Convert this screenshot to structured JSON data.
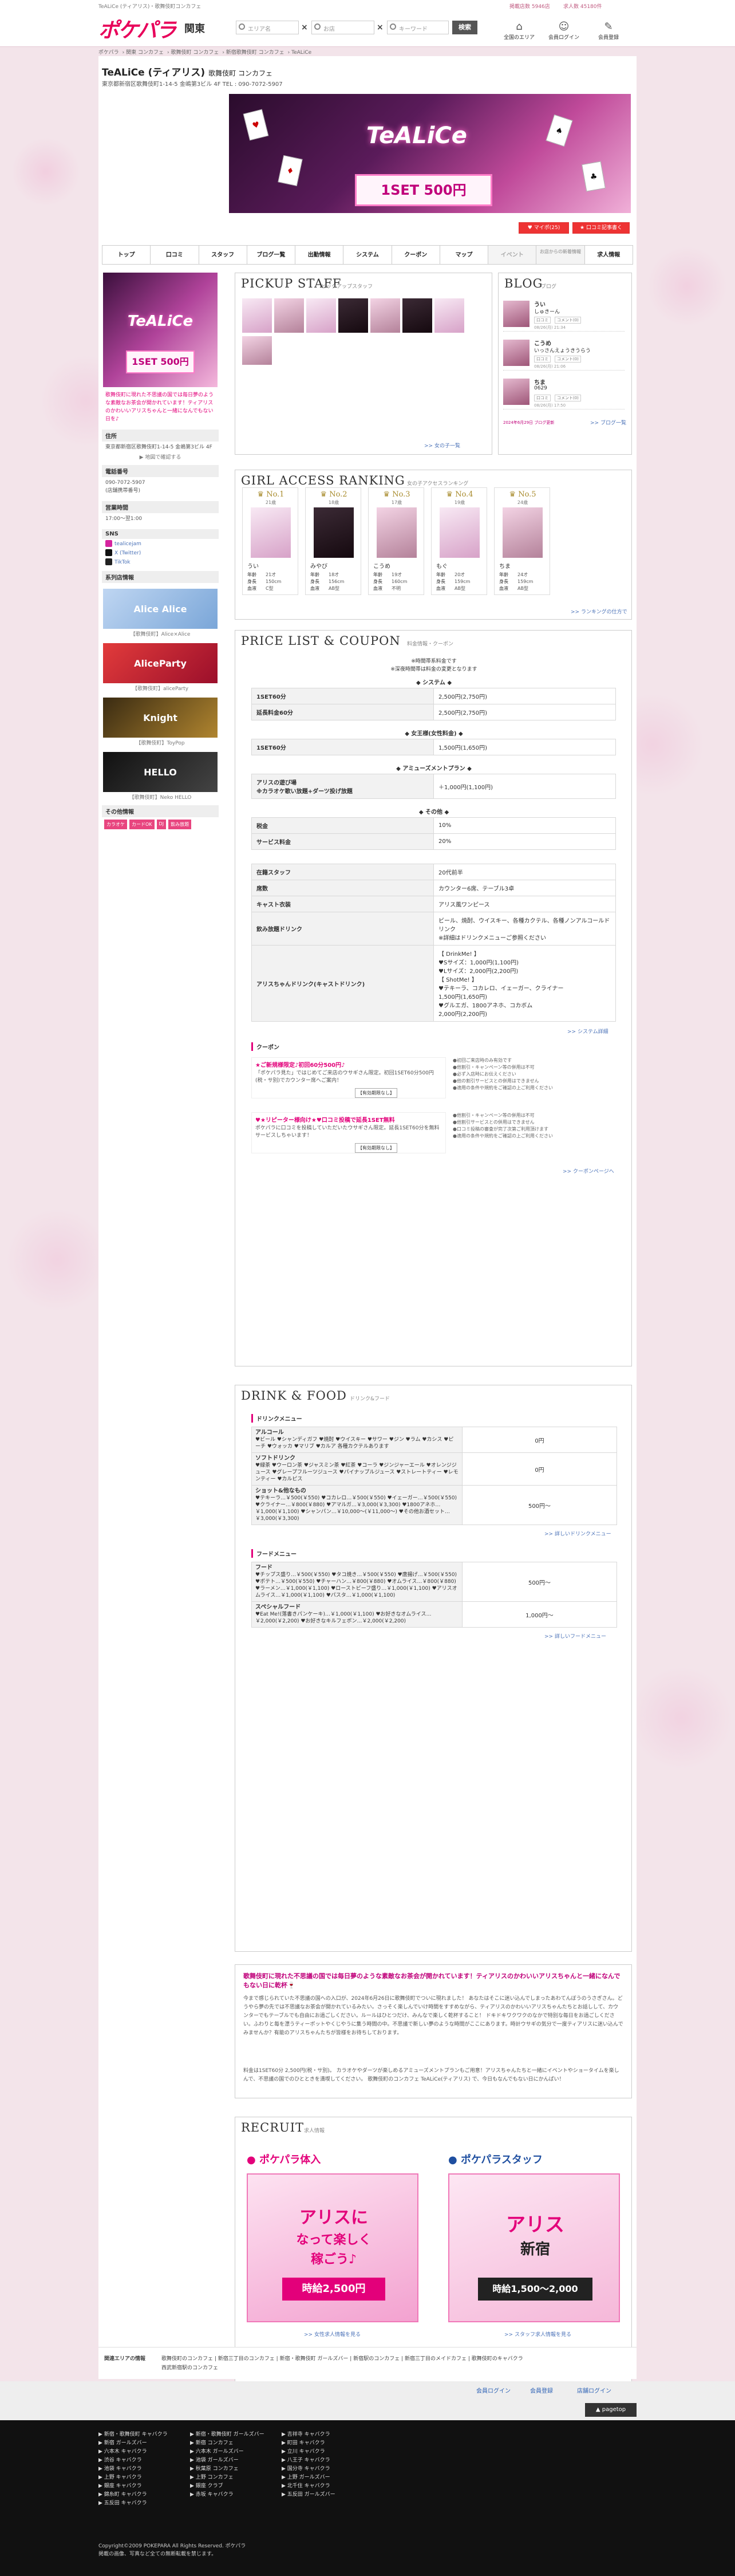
{
  "header": {
    "tagline": "TeALiCe (ティアリス)・歌舞伎町コンカフェ",
    "logo": "ポケパラ",
    "region": "関東",
    "search_area_placeholder": "エリア名",
    "search_shop_placeholder": "お店",
    "search_word_placeholder": "キーワード",
    "search_button": "検索",
    "link1": "掲載店数 5946店",
    "link2": "求人数 45180件",
    "icon1": "全国のエリア",
    "icon2": "会員ログイン",
    "icon3": "会員登録"
  },
  "breadcrumb": [
    "ポケパラ",
    "関東 コンカフェ",
    "歌舞伎町 コンカフェ",
    "新宿歌舞伎町 コンカフェ",
    "TeALiCe"
  ],
  "shop": {
    "name": "TeALiCe (ティアリス)",
    "genre": "歌舞伎町 コンカフェ",
    "address_line": "東京都新宿区歌舞伎町1-14-5 金嶋第3ビル 4F  TEL : 090-7072-5907",
    "hero_brand": "TeALiCe",
    "hero_price": "1SET 500円",
    "fav_button": "♥ マイポ(25)",
    "clip_button": "★ 口コミ記事書く"
  },
  "tabs": [
    "トップ",
    "口コミ",
    "スタッフ",
    "ブログ一覧",
    "出勤情報",
    "システム",
    "クーポン",
    "マップ",
    "イベント",
    "お店からの新着情報",
    "求人情報"
  ],
  "sidebar": {
    "promo_text": "歌舞伎町に現れた不思議の国では毎日夢のような素敵なお茶会が開かれています！ティアリスのかわいいアリスちゃんと一緒になんでもない日を♪",
    "addr_hd": "住所",
    "addr": "東京都新宿区歌舞伎町1-14-5 金嶋第3ビル 4F",
    "map_link": "▶ 地図で確認する",
    "tel_hd": "電話番号",
    "tel": "090-7072-5907",
    "tel_note": "(店舗携帯番号)",
    "hours_hd": "営業時間",
    "hours": "17:00〜翌1:00",
    "sns_hd": "SNS",
    "sns1": "tealicejam",
    "sns2": "X (Twitter)",
    "sns3": "TikTok",
    "group_hd": "系列店情報",
    "banners": [
      {
        "label": "Alice Alice",
        "caption": "【歌舞伎町】Alice×Alice"
      },
      {
        "label": "AliceParty",
        "caption": "【歌舞伎町】aliceParty"
      },
      {
        "label": "Knight",
        "caption": "【歌舞伎町】ToyPop"
      },
      {
        "label": "HELLO",
        "caption": "【歌舞伎町】Neko HELLO"
      }
    ],
    "others_hd": "その他情報",
    "chips": [
      "カラオケ",
      "カードOK",
      "DJ",
      "飲み放題"
    ]
  },
  "pickup": {
    "title": "PICKUP STAFF",
    "sub": "ピックアップスタッフ",
    "more": ">> 女の子一覧"
  },
  "blog": {
    "title": "BLOG",
    "sub": "ブログ",
    "items": [
      {
        "name": "うい",
        "title": "しゅきーん",
        "tag1": "スーパーSSS会員",
        "tag2": "口コミ",
        "tag3": "コメント(0)",
        "date": "08/26(月) 21:34"
      },
      {
        "name": "こうめ",
        "title": "いっさんえょうきうらう",
        "tag1": "スーパーSSS会員",
        "tag2": "口コミ",
        "tag3": "コメント(0)",
        "date": "08/26(月) 21:06"
      },
      {
        "name": "ちま",
        "title": "0629",
        "tag1": "スーパーSSS会員",
        "tag2": "口コミ",
        "tag3": "コメント(0)",
        "date": "08/26(月) 17:50"
      }
    ],
    "footer_note": "2024年6月29日 ブログ更新",
    "more": ">> ブログ一覧"
  },
  "ranking": {
    "title": "GIRL ACCESS RANKING",
    "sub": "女の子アクセスランキング",
    "girls": [
      {
        "no": "No.1",
        "age": "21歳",
        "name": "うい",
        "age_v": "21才",
        "height": "150cm",
        "cup": "C型"
      },
      {
        "no": "No.2",
        "age": "18歳",
        "name": "みやび",
        "age_v": "18才",
        "height": "156cm",
        "cup": "AB型"
      },
      {
        "no": "No.3",
        "age": "17歳",
        "name": "こうめ",
        "age_v": "19才",
        "height": "160cm",
        "cup": "不明"
      },
      {
        "no": "No.4",
        "age": "19歳",
        "name": "もぐ",
        "age_v": "20才",
        "height": "159cm",
        "cup": "AB型"
      },
      {
        "no": "No.5",
        "age": "24歳",
        "name": "ちま",
        "age_v": "24才",
        "height": "159cm",
        "cup": "AB型"
      }
    ],
    "stat_age": "年齢",
    "stat_height": "身長",
    "stat_blood": "血液",
    "more": ">> ランキングの仕方で"
  },
  "price": {
    "title": "PRICE LIST & COUPON",
    "sub": "料金情報・クーポン",
    "note1": "※時間帯系料金です",
    "note2": "※深夜時間帯は料金の変更となります",
    "sections": [
      {
        "head": "◆ システム ◆",
        "rows": [
          [
            "1SET60分",
            "2,500円(2,750円)"
          ],
          [
            "延長料金60分",
            "2,500円(2,750円)"
          ]
        ]
      },
      {
        "head": "◆ 女王様(女性料金) ◆",
        "rows": [
          [
            "1SET60分",
            "1,500円(1,650円)"
          ]
        ]
      },
      {
        "head": "◆ アミューズメントプラン ◆",
        "rows": [
          [
            "アリスの遊び場\n※カラオケ歌い放題+ダーツ投げ放題",
            "＋1,000円(1,100円)"
          ]
        ]
      },
      {
        "head": "◆ その他 ◆",
        "rows": [
          [
            "税金",
            "10%"
          ],
          [
            "サービス料金",
            "20%"
          ]
        ]
      }
    ],
    "extra": [
      [
        "在籍スタッフ",
        "20代前半"
      ],
      [
        "席数",
        "カウンター6席、テーブル3卓"
      ],
      [
        "キャスト衣装",
        "アリス風ワンピース"
      ],
      [
        "飲み放題ドリンク",
        "ビール、焼酎、ウイスキー、各種カクテル、各種ノンアルコールドリンク\n※詳細はドリンクメニューご参照ください"
      ],
      [
        "アリスちゃんドリンク(キャストドリンク)",
        "【 DrinkMe! 】\n♥Sサイズ：1,000円(1,100円)\n♥Lサイズ：2,000円(2,200円)\n【 ShotMe! 】\n♥テキーラ、コカレロ、イェーガー、クライナー\n1,500円(1,650円)\n♥グルエガ、1800アネホ、コカボム\n2,000円(2,200円)"
      ]
    ],
    "system_more": ">> システム詳細",
    "coupon_hd": "クーポン",
    "coupons": [
      {
        "title": "★ご新規様限定♪初回60分500円♪",
        "desc": "「ポケパラ見た」ではじめてご来店のウサギさん限定。初回1SET60分500円(税・サ別)でカウンター席へご案内！",
        "btn": "【有効期限なし】"
      },
      {
        "title": "♥★リピーター様向け★♥口コミ投稿で延長1SET無料",
        "desc": "ポケパラに口コミを投稿していただいたウサギさん限定。延長1SET60分を無料サービスしちゃいます！",
        "btn": "【有効期限なし】"
      }
    ],
    "coupon_notes": [
      "●初回ご来店時のみ有効です\n●他割引・キャンペーン等の併用は不可\n●必ず入店時にお伝えください\n●他の割引サービスとの併用はできません\n●適用の条件や規約をご確認の上ご利用ください",
      "●他割引・キャンペーン等の併用は不可\n●他割引サービスとの併用はできません\n●口コミ投稿の審査が完了次第ご利用頂けます\n●適用の条件や規約をご確認の上ご利用ください"
    ],
    "coupon_more": ">> クーポンページへ"
  },
  "drink": {
    "title": "DRINK & FOOD",
    "sub": "ドリンク&フード",
    "drink_hd": "ドリンクメニュー",
    "drinks": [
      {
        "name": "アルコール",
        "desc": "♥ビール ♥シャンディガフ ♥焼酎 ♥ウイスキー ♥サワー ♥ジン ♥ラム ♥カシス ♥ピーチ ♥ウォッカ ♥マリブ ♥カルア 各種カクテルあります",
        "price": "0円"
      },
      {
        "name": "ソフトドリンク",
        "desc": "♥緑茶 ♥ウーロン茶 ♥ジャスミン茶 ♥紅茶 ♥コーラ ♥ジンジャーエール ♥オレンジジュース ♥グレープフルーツジュース ♥パイナップルジュース ♥ストレートティー ♥レモンティー ♥カルピス",
        "price": "0円"
      },
      {
        "name": "ショット&他なもの",
        "desc": "♥テキーラ…￥500(￥550) ♥コカレロ…￥500(￥550) ♥イェーガー…￥500(￥550) ♥クライナー…￥800(￥880) ♥アマルガ…￥3,000(￥3,300) ♥1800アネホ…￥1,000(￥1,100) ♥シャンパン…￥10,000〜(￥11,000〜) ♥その他お酒セット…￥3,000(￥3,300)",
        "price": "500円〜"
      }
    ],
    "drink_more": ">> 詳しいドリンクメニュー",
    "food_hd": "フードメニュー",
    "foods": [
      {
        "name": "フード",
        "desc": "♥チップス盛り…￥500(￥550) ♥タコ焼き…￥500(￥550) ♥唐揚げ…￥500(￥550) ♥ポテト…￥500(￥550) ♥チャーハン…￥800(￥880) ♥オムライス…￥800(￥880) ♥ラーメン…￥1,000(￥1,100) ♥ローストビーフ盛り…￥1,000(￥1,100) ♥アリスオムライス…￥1,000(￥1,100) ♥パスタ…￥1,000(￥1,100)",
        "price": "500円〜"
      },
      {
        "name": "スペシャルフード",
        "desc": "♥Eat Me!(落書きパンケーキ)…￥1,000(￥1,100) ♥お好きなオムライス…￥2,000(￥2,200) ♥お好きなキルフェボン…￥2,000(￥2,200)",
        "price": "1,000円〜"
      }
    ],
    "food_more": ">> 詳しいフードメニュー"
  },
  "intro": {
    "title": "歌舞伎町に現れた不思議の国では毎日夢のような素敵なお茶会が開かれています！ティアリスのかわいいアリスちゃんと一緒になんでもない日に乾杯🍷",
    "body": "今まで感じられていた不思議の国への入口が、2024年6月26日に歌舞伎町でついに現れました！ あなたはそこに迷い込んでしまったあわてんぼうのうさぎさん。どうやら夢の先では不思議なお茶会が開かれているみたい。さっそく楽しんでいけ時間をすすめながら、ティアリスのかわいいアリスちゃんたちとお話しして、カウンターでもテーブルでも自由にお過ごしください。ルールはひとつだけ、みんなで楽しく乾杯すること！ ドキドキワクワクのなかで特別な毎日をお過ごしください。ふわりと毎を漂うティーポットやくじやうに集う時間の中。不思議で新しい夢のような時間がここにあります。時計ウサギの気分で一度ティアリスに迷い込んでみませんか？有能のアリスちゃんたちが皆様をお待ちしております。",
    "body2": "料金は1SET60分 2,500円(税・サ別)。 カラオケやダーツが楽しめるアミューズメントプランもご用意！アリスちゃんたちと一緒にイベントやショータイムを楽しんで、不思議の国でのひとときを満喫してください。 歌舞伎町のコンカフェ TeALiCe(ティアリス) で、今日もなんでもない日にかんぱい！"
  },
  "recruit": {
    "title": "RECRUIT",
    "sub": "求人情報",
    "left_brand": "ポケパラ体入",
    "right_brand": "ポケパラスタッフ",
    "left_banner_a": "アリスに",
    "left_banner_b": "なって楽しく",
    "left_banner_c": "稼ごう♪",
    "left_price": "時給2,500円",
    "right_banner_a": "アリス",
    "right_banner_b": "新宿",
    "right_price": "時給1,500〜2,000",
    "left_more": ">> 女性求人情報を見る",
    "right_more": ">> スタッフ求人情報を見る"
  },
  "footer": {
    "links_hd": "関連エリアの情報",
    "links": [
      "歌舞伎町のコンカフェ",
      "新宿三丁目のコンカフェ",
      "新宿・歌舞伎町 ガールズバー",
      "新宿駅のコンカフェ",
      "新宿三丁目のメイドカフェ",
      "歌舞伎町のキャバクラ",
      "西武新宿駅のコンカフェ"
    ],
    "top1": "会員ログイン",
    "top2": "会員登録",
    "top3": "店舗ログイン",
    "pagetop": "▲ pagetop",
    "cols": [
      [
        "▶ 新宿・歌舞伎町 キャバクラ",
        "▶ 新宿 ガールズバー",
        "▶ 六本木 キャバクラ",
        "▶ 渋谷 キャバクラ",
        "▶ 池袋 キャバクラ",
        "▶ 上野 キャバクラ",
        "▶ 銀座 キャバクラ",
        "▶ 錦糸町 キャバクラ",
        "▶ 五反田 キャバクラ"
      ],
      [
        "▶ 新宿・歌舞伎町 ガールズバー",
        "▶ 新宿 コンカフェ",
        "▶ 六本木 ガールズバー",
        "▶ 池袋 ガールズバー",
        "▶ 秋葉原 コンカフェ",
        "▶ 上野 コンカフェ",
        "▶ 銀座 クラブ",
        "▶ 赤坂 キャバクラ"
      ],
      [
        "▶ 吉祥寺 キャバクラ",
        "▶ 町田 キャバクラ",
        "▶ 立川 キャバクラ",
        "▶ 八王子 キャバクラ",
        "▶ 国分寺 キャバクラ",
        "▶ 上野 ガールズバー",
        "▶ 北千住 キャバクラ",
        "▶ 五反田 ガールズバー"
      ]
    ],
    "copyright": "Copyright©2009 POKEPARA All Rights Reserved. ポケパラ",
    "copyright2": "掲載の画像、写真など全ての無断転載を禁じます。"
  }
}
